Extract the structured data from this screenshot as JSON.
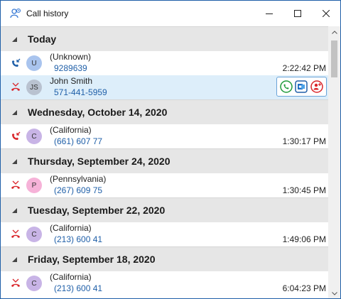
{
  "window": {
    "title": "Call history",
    "icon": "call-history-app-icon",
    "controls": [
      "minimize",
      "maximize",
      "close"
    ]
  },
  "colors": {
    "accent_blue": "#1f5fa8",
    "missed_red": "#d9252a",
    "selected_row": "#ddeefa",
    "group_header_bg": "#e6e6e6"
  },
  "groups": [
    {
      "header": "Today",
      "calls": [
        {
          "direction": "incoming",
          "direction_icon": "incoming-call-icon",
          "avatar_letter": "U",
          "avatar_color": "#a9c4ee",
          "name": "(Unknown)",
          "number": "9289639",
          "time": "2:22:42 PM",
          "selected": false
        },
        {
          "direction": "missed",
          "direction_icon": "missed-call-icon",
          "avatar_letter": "JS",
          "avatar_color": "#b9c2d0",
          "name": "John Smith",
          "number": "571-441-5959",
          "time": "",
          "selected": true,
          "actions": [
            "call-icon",
            "outlook-icon",
            "add-contact-icon"
          ]
        }
      ]
    },
    {
      "header": "Wednesday, October 14, 2020",
      "calls": [
        {
          "direction": "incoming-red",
          "direction_icon": "incoming-call-icon",
          "avatar_letter": "C",
          "avatar_color": "#c8b4e6",
          "name": "(California)",
          "number": "(661) 607 77",
          "time": "1:30:17 PM",
          "selected": false
        }
      ]
    },
    {
      "header": "Thursday, September 24, 2020",
      "calls": [
        {
          "direction": "missed",
          "direction_icon": "missed-call-icon",
          "avatar_letter": "P",
          "avatar_color": "#f6b2d8",
          "name": "(Pennsylvania)",
          "number": "(267) 609 75",
          "time": "1:30:45 PM",
          "selected": false
        }
      ]
    },
    {
      "header": "Tuesday, September 22, 2020",
      "calls": [
        {
          "direction": "missed",
          "direction_icon": "missed-call-icon",
          "avatar_letter": "C",
          "avatar_color": "#c8b4e6",
          "name": "(California)",
          "number": "(213) 600 41",
          "time": "1:49:06 PM",
          "selected": false
        }
      ]
    },
    {
      "header": "Friday, September 18, 2020",
      "calls": [
        {
          "direction": "missed",
          "direction_icon": "missed-call-icon",
          "avatar_letter": "C",
          "avatar_color": "#c8b4e6",
          "name": "(California)",
          "number": "(213) 600 41",
          "time": "6:04:23 PM",
          "selected": false
        }
      ]
    }
  ]
}
